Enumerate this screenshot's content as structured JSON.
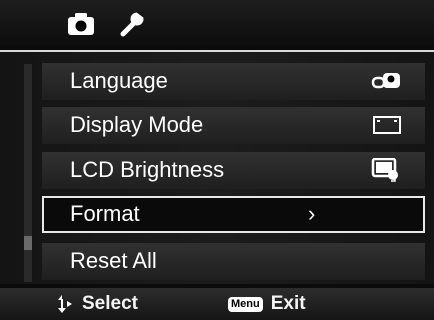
{
  "tabs": [
    {
      "icon": "camera-icon"
    },
    {
      "icon": "wrench-icon"
    }
  ],
  "menu": {
    "items": [
      {
        "label": "Language",
        "icon": "language-icon"
      },
      {
        "label": "Display Mode",
        "icon": "display-mode-icon"
      },
      {
        "label": "LCD Brightness",
        "icon": "lcd-brightness-auto-icon"
      },
      {
        "label": "Format",
        "indicator": "›",
        "selected": true
      },
      {
        "label": "Reset All"
      }
    ]
  },
  "footer": {
    "select_label": "Select",
    "menu_badge": "Menu",
    "exit_label": "Exit"
  },
  "colors": {
    "background": "#0b0b0b",
    "row": "#2a2a2a",
    "highlight_border": "#e8e8e8",
    "text": "#ffffff"
  }
}
